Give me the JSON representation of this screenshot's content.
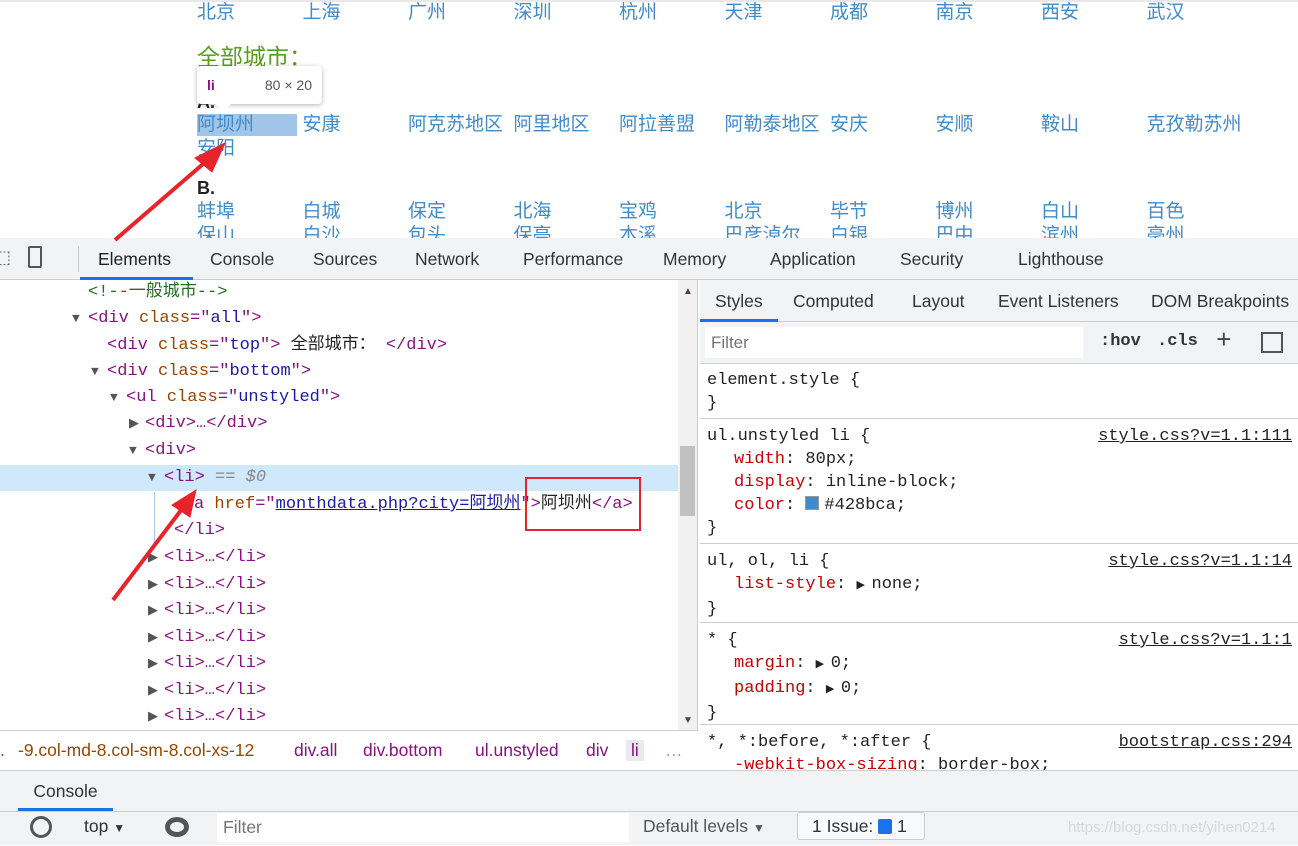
{
  "page": {
    "hot_cities": [
      "北京",
      "上海",
      "广州",
      "深圳",
      "杭州",
      "天津",
      "成都",
      "南京",
      "西安",
      "武汉"
    ],
    "all_title": "全部城市：",
    "tooltip": {
      "tag": "li",
      "size": "80 × 20"
    },
    "groups": [
      {
        "letter": "A.",
        "rows": [
          [
            "阿坝州",
            "安康",
            "阿克苏地区",
            "阿里地区",
            "阿拉善盟",
            "阿勒泰地区",
            "安庆",
            "安顺",
            "鞍山",
            "克孜勒苏州"
          ],
          [
            "安阳"
          ]
        ]
      },
      {
        "letter": "B.",
        "rows": [
          [
            "蚌埠",
            "白城",
            "保定",
            "北海",
            "宝鸡",
            "北京",
            "毕节",
            "博州",
            "白山",
            "百色"
          ],
          [
            "保山",
            "白沙",
            "包头",
            "保亭",
            "本溪",
            "巴彦淖尔",
            "白银",
            "巴中",
            "滨州",
            "亳州"
          ]
        ]
      }
    ]
  },
  "devtools": {
    "tabs": [
      "Elements",
      "Console",
      "Sources",
      "Network",
      "Performance",
      "Memory",
      "Application",
      "Security",
      "Lighthouse"
    ],
    "dom": {
      "comment": "<!--一般城市-->",
      "div_all": [
        "<div",
        " class",
        "=\"",
        "all",
        "\">"
      ],
      "div_top": [
        "<div",
        " class",
        "=\"",
        "top",
        "\">",
        " 全部城市： ",
        "</div>"
      ],
      "div_bottom": [
        "<div",
        " class",
        "=\"",
        "bottom",
        "\">"
      ],
      "ul": [
        "<ul",
        " class",
        "=\"",
        "unstyled",
        "\">"
      ],
      "div_collapsed": "<div>…</div>",
      "div_open": "<div>",
      "li_selected": "<li>",
      "li_marker": " == $0",
      "a_line": [
        "a",
        " href",
        "=\"",
        "monthdata.php?city=阿坝州",
        "\">",
        "阿坝州",
        "</a>"
      ],
      "li_close": "</li>",
      "li_collapsed": "<li>…</li>"
    },
    "breadcrumb": [
      "-9.col-md-8.col-sm-8.col-xs-12",
      "div.all",
      "div.bottom",
      "ul.unstyled",
      "div",
      "li"
    ],
    "styles": {
      "tabs": [
        "Styles",
        "Computed",
        "Layout",
        "Event Listeners",
        "DOM Breakpoints"
      ],
      "filter_placeholder": "Filter",
      "hov": ":hov",
      "cls": ".cls",
      "rules": [
        {
          "selector": "element.style {",
          "source": "",
          "props": []
        },
        {
          "selector": "ul.unstyled li {",
          "source": "style.css?v=1.1:111",
          "props": [
            [
              "width",
              "80px"
            ],
            [
              "display",
              "inline-block"
            ],
            [
              "color",
              "#428bca"
            ]
          ]
        },
        {
          "selector": "ul, ol, li {",
          "source": "style.css?v=1.1:14",
          "props": [
            [
              "list-style",
              "none"
            ]
          ]
        },
        {
          "selector": "* {",
          "source": "style.css?v=1.1:1",
          "props": [
            [
              "margin",
              "0"
            ],
            [
              "padding",
              "0"
            ]
          ]
        },
        {
          "selector": "*, *:before, *:after {",
          "source": "bootstrap.css:294",
          "props": [
            [
              "-webkit-box-sizing",
              "border-box"
            ]
          ]
        }
      ]
    },
    "drawer": {
      "tab": "Console",
      "context": "top",
      "filter_placeholder": "Filter",
      "levels": "Default levels",
      "issues_label": "1 Issue:",
      "issues_count": "1"
    },
    "watermark": "https://blog.csdn.net/yihen0214"
  },
  "colors": {
    "link": "#428bca",
    "accent": "#1a73e8",
    "annotation": "#e8232a"
  }
}
